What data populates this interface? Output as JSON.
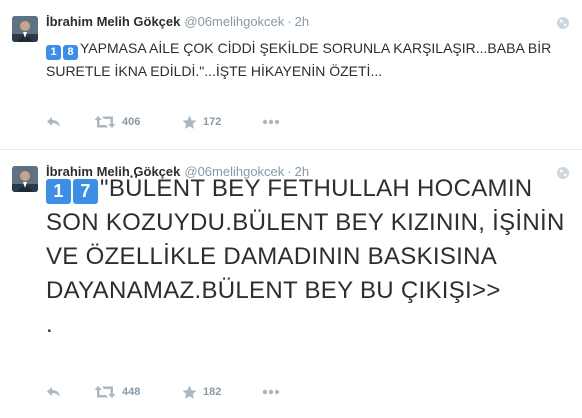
{
  "tweets": [
    {
      "author_name": "İbrahim Melih Gökçek",
      "handle": "@06melihgokcek",
      "separator": "·",
      "time": "2h",
      "keycap_1": "1",
      "keycap_2": "8",
      "text": "YAPMASA AİLE ÇOK CİDDİ ŞEKİLDE SORUNLA KARŞILAŞIR...BABA BİR SURETLE İKNA EDİLDİ.\"...İŞTE HİKAYENİN ÖZETİ...",
      "retweets": "406",
      "favorites": "172",
      "icons": [
        "reply-icon",
        "retweet-icon",
        "favorite-icon",
        "more-icon",
        "globe-icon"
      ]
    },
    {
      "author_name": "İbrahim Melih Gökçek",
      "handle": "@06melihgokcek",
      "separator": "·",
      "time": "2h",
      "keycap_1": "1",
      "keycap_2": "7",
      "text": "\"BÜLENT BEY FETHULLAH HOCAMIN SON KOZUYDU.BÜLENT BEY KIZININ, İŞİNİN VE ÖZELLİKLE DAMADININ BASKISINA DAYANAMAZ.BÜLENT BEY BU ÇIKIŞI>>",
      "trailing": ".",
      "retweets": "448",
      "favorites": "182",
      "icons": [
        "reply-icon",
        "retweet-icon",
        "favorite-icon",
        "more-icon",
        "globe-icon"
      ]
    }
  ],
  "colors": {
    "name": "#292f33",
    "meta": "#8899a6",
    "keycap": "#3d8fe6",
    "divider": "#e6ecf0"
  }
}
